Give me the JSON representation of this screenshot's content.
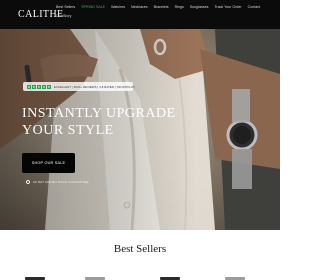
{
  "header": {
    "logo": "CALITHE",
    "nav": [
      {
        "label": "Best Sellers",
        "highlight": false
      },
      {
        "label": "SPRING SALE",
        "highlight": true
      },
      {
        "label": "Watches",
        "highlight": false
      },
      {
        "label": "Necklaces",
        "highlight": false
      },
      {
        "label": "Bracelets",
        "highlight": false
      },
      {
        "label": "Rings",
        "highlight": false
      },
      {
        "label": "Sunglasses",
        "highlight": false
      },
      {
        "label": "Track Your Order",
        "highlight": false
      },
      {
        "label": "Contact",
        "highlight": false
      },
      {
        "label": "Our Story",
        "highlight": false
      }
    ]
  },
  "hero": {
    "rating_text": "EXCELLENT | 5000+ REVIEWS | 4.8 RATED | TRUSTPILOT",
    "rating_stars": 5,
    "title_line1": "INSTANTLY UPGRADE",
    "title_line2": "YOUR STYLE",
    "cta_label": "SHOP OUR SALE",
    "guarantee_text": "30 DAY MONEY BACK GUARANTEE"
  },
  "best_sellers": {
    "title": "Best Sellers"
  },
  "colors": {
    "header_bg": "#0b0b0b",
    "accent_green": "#4fa85a",
    "trustpilot_green": "#2fa24a",
    "button_bg": "#050505"
  }
}
